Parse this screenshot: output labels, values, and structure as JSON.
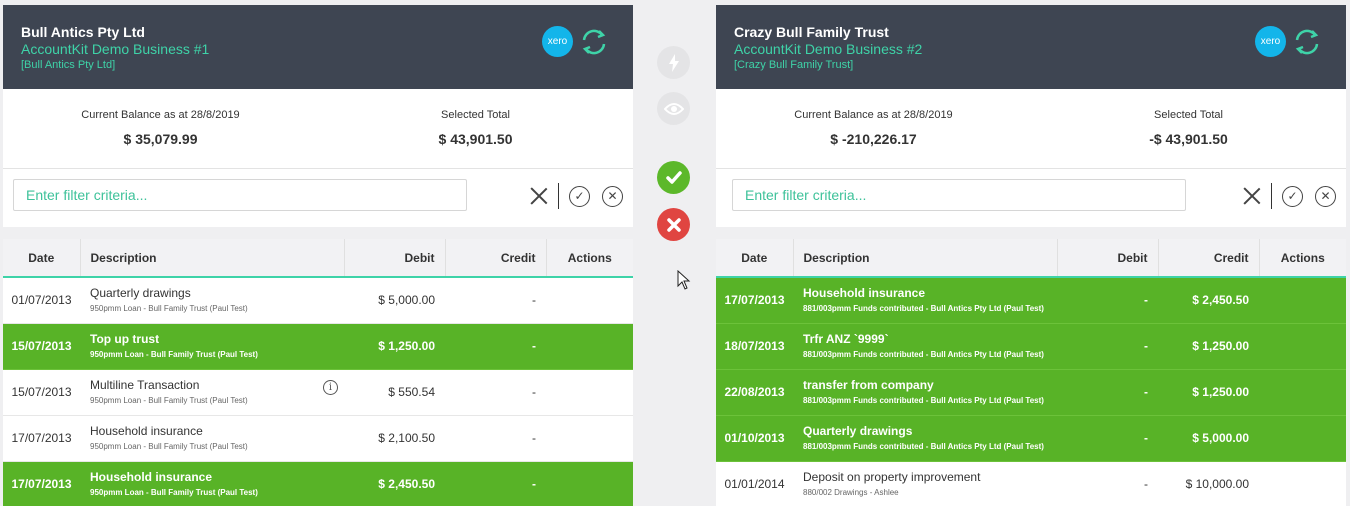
{
  "left": {
    "name": "Bull Antics Pty Ltd",
    "business": "AccountKit Demo Business #1",
    "entity": "[Bull Antics Pty Ltd]",
    "xero_label": "xero",
    "balance_label": "Current Balance as at 28/8/2019",
    "balance_value": "$ 35,079.99",
    "selected_label": "Selected Total",
    "selected_value": "$ 43,901.50",
    "filter_placeholder": "Enter filter criteria...",
    "columns": [
      "Date",
      "Description",
      "Debit",
      "Credit",
      "Actions"
    ],
    "rows": [
      {
        "date": "01/07/2013",
        "desc": "Quarterly drawings",
        "sub": "950pmm Loan - Bull Family Trust (Paul Test)",
        "debit": "$ 5,000.00",
        "credit": "-",
        "selected": false,
        "info": false
      },
      {
        "date": "15/07/2013",
        "desc": "Top up trust",
        "sub": "950pmm Loan - Bull Family Trust (Paul Test)",
        "debit": "$ 1,250.00",
        "credit": "-",
        "selected": true,
        "info": false
      },
      {
        "date": "15/07/2013",
        "desc": "Multiline Transaction",
        "sub": "950pmm Loan - Bull Family Trust (Paul Test)",
        "debit": "$ 550.54",
        "credit": "-",
        "selected": false,
        "info": true
      },
      {
        "date": "17/07/2013",
        "desc": "Household insurance",
        "sub": "950pmm Loan - Bull Family Trust (Paul Test)",
        "debit": "$ 2,100.50",
        "credit": "-",
        "selected": false,
        "info": false
      },
      {
        "date": "17/07/2013",
        "desc": "Household insurance",
        "sub": "950pmm Loan - Bull Family Trust (Paul Test)",
        "debit": "$ 2,450.50",
        "credit": "-",
        "selected": true,
        "info": false
      }
    ]
  },
  "right": {
    "name": "Crazy Bull Family Trust",
    "business": "AccountKit Demo Business #2",
    "entity": "[Crazy Bull Family Trust]",
    "xero_label": "xero",
    "balance_label": "Current Balance as at 28/8/2019",
    "balance_value": "$ -210,226.17",
    "selected_label": "Selected Total",
    "selected_value": "-$ 43,901.50",
    "filter_placeholder": "Enter filter criteria...",
    "columns": [
      "Date",
      "Description",
      "Debit",
      "Credit",
      "Actions"
    ],
    "rows": [
      {
        "date": "17/07/2013",
        "desc": "Household insurance",
        "sub": "881/003pmm Funds contributed - Bull Antics Pty Ltd (Paul Test)",
        "debit": "-",
        "credit": "$ 2,450.50",
        "selected": true,
        "info": false
      },
      {
        "date": "18/07/2013",
        "desc": "Trfr ANZ `9999`",
        "sub": "881/003pmm Funds contributed - Bull Antics Pty Ltd (Paul Test)",
        "debit": "-",
        "credit": "$ 1,250.00",
        "selected": true,
        "info": false
      },
      {
        "date": "22/08/2013",
        "desc": "transfer from company",
        "sub": "881/003pmm Funds contributed - Bull Antics Pty Ltd (Paul Test)",
        "debit": "-",
        "credit": "$ 1,250.00",
        "selected": true,
        "info": false
      },
      {
        "date": "01/10/2013",
        "desc": "Quarterly drawings",
        "sub": "881/003pmm Funds contributed - Bull Antics Pty Ltd (Paul Test)",
        "debit": "-",
        "credit": "$ 5,000.00",
        "selected": true,
        "info": false
      },
      {
        "date": "01/01/2014",
        "desc": "Deposit on property improvement",
        "sub": "880/002 Drawings - Ashlee",
        "debit": "-",
        "credit": "$ 10,000.00",
        "selected": false,
        "info": false
      }
    ]
  },
  "middle": {
    "buttons": [
      "lightning-icon",
      "eye-icon",
      "check-icon",
      "cross-icon"
    ]
  },
  "colors": {
    "header_bg": "#3e4552",
    "accent": "#3ed3a8",
    "selected_row": "#58b327",
    "confirm": "#5cb82a",
    "reject": "#e04541",
    "xero": "#13b5ea"
  }
}
